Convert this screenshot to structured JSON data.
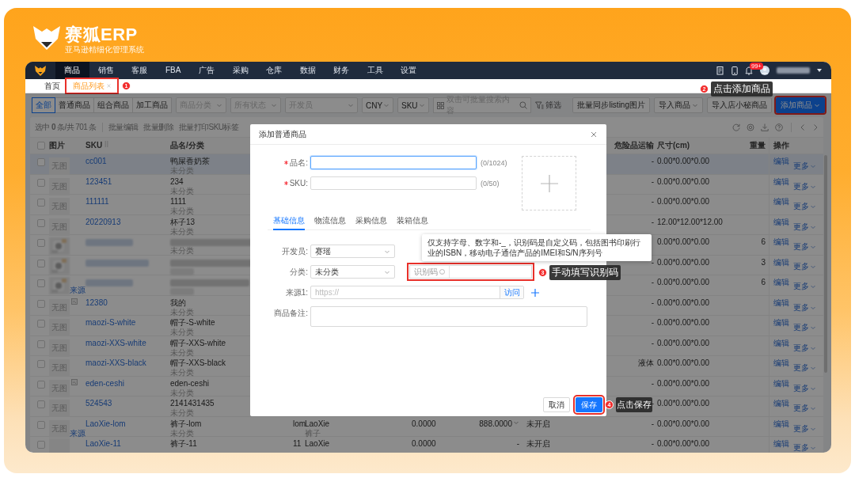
{
  "brand": {
    "name": "赛狐ERP",
    "tagline": "亚马逊精细化管理系统"
  },
  "nav": {
    "items": [
      {
        "label": "商品",
        "selected": true
      },
      {
        "label": "销售",
        "selected": false
      },
      {
        "label": "客服",
        "selected": false
      },
      {
        "label": "FBA",
        "selected": false
      },
      {
        "label": "广告",
        "selected": false
      },
      {
        "label": "采购",
        "selected": false
      },
      {
        "label": "仓库",
        "selected": false
      },
      {
        "label": "数据",
        "selected": false
      },
      {
        "label": "财务",
        "selected": false
      },
      {
        "label": "工具",
        "selected": false
      },
      {
        "label": "设置",
        "selected": false
      }
    ],
    "notification_badge": "99+"
  },
  "tabs": [
    {
      "label": "首页",
      "selected": false,
      "closable": false,
      "highlighted": false
    },
    {
      "label": "商品列表",
      "selected": true,
      "closable": true,
      "highlighted": true
    }
  ],
  "toolbar": {
    "segments": [
      {
        "label": "全部",
        "selected": true
      },
      {
        "label": "普通商品",
        "selected": false
      },
      {
        "label": "组合商品",
        "selected": false
      },
      {
        "label": "加工商品",
        "selected": false
      }
    ],
    "selects": [
      {
        "placeholder": "商品分类"
      },
      {
        "placeholder": "所有状态"
      },
      {
        "placeholder": "开发员"
      },
      {
        "value": "CNY"
      },
      {
        "value": "SKU"
      }
    ],
    "search": {
      "placeholder": "双击可批量搜索内容"
    },
    "filter": "筛选",
    "buttons": [
      {
        "label": "批量同步listing图片",
        "kind": "plain",
        "highlighted": false
      },
      {
        "label": "导入商品",
        "kind": "dropdown",
        "highlighted": false
      },
      {
        "label": "导入店小秘商品",
        "kind": "plain",
        "highlighted": false
      },
      {
        "label": "添加商品",
        "kind": "primary",
        "highlighted": true
      }
    ]
  },
  "bulk_bar": {
    "summary": "选中 **0** 条/共 701 条",
    "actions": [
      "批量编辑",
      "批量删除",
      "批量打印SKU标签"
    ]
  },
  "table": {
    "all_checked": false,
    "columns": [
      "图片",
      "SKU",
      "品名/分类",
      "危险品运输",
      "尺寸(cm)",
      "重量",
      "操作"
    ],
    "rows": [
      {
        "kind": "normal",
        "selected": true,
        "checked": false,
        "image": {
          "kind": "placeholder",
          "text": "无图"
        },
        "marked": false,
        "sku": "cc001",
        "name": "鸭屎香奶茶",
        "category": "未分类",
        "danger": "-",
        "size": "0.00*0.00*0.00",
        "actions": [
          "编辑",
          "更多"
        ]
      },
      {
        "kind": "normal",
        "selected": false,
        "checked": false,
        "image": {
          "kind": "placeholder",
          "text": "无图"
        },
        "marked": false,
        "sku": "123451",
        "name": "234",
        "category": "未分类",
        "danger": "-",
        "size": "0.00*0.00*0.00",
        "actions": [
          "编辑",
          "更多"
        ]
      },
      {
        "kind": "normal",
        "selected": false,
        "checked": false,
        "image": {
          "kind": "placeholder",
          "text": "无图"
        },
        "marked": false,
        "sku": "111111",
        "name": "1111",
        "category": "未分类",
        "danger": "-",
        "size": "0.00*0.00*0.00",
        "actions": [
          "编辑",
          "更多"
        ]
      },
      {
        "kind": "normal",
        "selected": false,
        "checked": false,
        "image": {
          "kind": "placeholder",
          "text": "无图"
        },
        "marked": false,
        "sku": "20220913",
        "name": "杯子13",
        "category": "未分类",
        "danger": "-",
        "size": "12.00*12.00*12.00",
        "actions": [
          "编辑",
          "更多"
        ]
      },
      {
        "kind": "blurred",
        "selected": false,
        "checked": false,
        "image": {
          "kind": "picture"
        },
        "marked": false,
        "category": "未分类",
        "size": "0.00*0.00*0.00",
        "weight": "6",
        "actions": [
          "编辑",
          "更多"
        ]
      },
      {
        "kind": "blurred",
        "selected": false,
        "checked": false,
        "image": {
          "kind": "picture"
        },
        "marked": false,
        "danger": "-",
        "size": "0.00*0.00*0.00",
        "weight": "3",
        "actions": [
          "编辑",
          "更多"
        ]
      },
      {
        "kind": "blurred",
        "selected": false,
        "checked": false,
        "image": {
          "kind": "picture"
        },
        "marked": false,
        "source_link": "来源",
        "danger": "-",
        "size": "0.00*0.00*0.00",
        "weight": "6",
        "actions": [
          "编辑",
          "更多"
        ]
      },
      {
        "kind": "normal",
        "selected": false,
        "checked": false,
        "image": {
          "kind": "placeholder",
          "text": "无图"
        },
        "marked": true,
        "sku": "12380",
        "name": "我的",
        "category": "未分类",
        "danger": "-",
        "size": "0.00*0.00*0.00",
        "actions": [
          "编辑",
          "更多"
        ]
      },
      {
        "kind": "normal",
        "selected": false,
        "checked": false,
        "image": {
          "kind": "placeholder",
          "text": "无图"
        },
        "marked": false,
        "sku": "maozi-S-white",
        "name": "帽子-S-white",
        "category": "未分类",
        "danger": "-",
        "size": "0.00*0.00*0.00",
        "actions": [
          "编辑",
          "更多"
        ]
      },
      {
        "kind": "normal",
        "selected": false,
        "checked": false,
        "image": {
          "kind": "placeholder",
          "text": "无图"
        },
        "marked": false,
        "sku": "maozi-XXS-white",
        "name": "帽子-XXS-white",
        "category": "未分类",
        "danger": "-",
        "size": "0.00*0.00*0.00",
        "actions": [
          "编辑",
          "更多"
        ]
      },
      {
        "kind": "normal",
        "selected": false,
        "checked": false,
        "image": {
          "kind": "placeholder",
          "text": "无图"
        },
        "marked": false,
        "sku": "maozi-XXS-black",
        "name": "帽子-XXS-black",
        "category": "未分类",
        "danger": "液体",
        "size": "0.00*0.00*0.00",
        "actions": [
          "编辑",
          "更多"
        ]
      },
      {
        "kind": "normal",
        "selected": false,
        "checked": false,
        "image": {
          "kind": "placeholder",
          "text": "无图"
        },
        "marked": true,
        "sku": "eden-ceshi",
        "name": "eden-ceshi",
        "category": "未分类",
        "danger": "-",
        "size": "0.00*0.00*0.00",
        "actions": [
          "编辑",
          "更多"
        ]
      },
      {
        "kind": "normal",
        "selected": false,
        "checked": false,
        "image": {
          "kind": "placeholder",
          "text": "无图"
        },
        "marked": false,
        "sku": "524543",
        "name": "2141431435",
        "category": "未分类",
        "danger": "-",
        "size": "0.00*0.00*0.00",
        "actions": [
          "编辑",
          "更多"
        ]
      },
      {
        "kind": "normal",
        "selected": false,
        "checked": false,
        "image": {
          "kind": "placeholder",
          "text": "无图"
        },
        "marked": false,
        "source_link": "来源",
        "sku": "LaoXie-lom",
        "name": "裤子-lom",
        "category": "未分类",
        "column_5": "lom",
        "column_6": "LaoXie",
        "column_6_sub": "裤子",
        "column_7": "0.0000",
        "column_8": "888.0000",
        "column_8_dropdown": true,
        "column_9": "未开启",
        "danger": "-",
        "size": "0.00*0.00*0.00",
        "actions": [
          "编辑",
          "更多"
        ]
      },
      {
        "kind": "normal",
        "selected": false,
        "checked": false,
        "image": {
          "kind": "placeholder"
        },
        "marked": false,
        "sku": "LaoXie-11",
        "name": "裤子-11",
        "column_5": "11",
        "column_6": "LaoXie",
        "column_7": "0.0000",
        "column_8": "-",
        "column_8_dropdown": false,
        "column_9": "未开启",
        "danger": "-",
        "size": "0.00*0.00*0.00",
        "actions": [
          "编辑",
          "更多"
        ]
      }
    ]
  },
  "dialog": {
    "title": "添加普通商品",
    "header_fields": [
      {
        "label": "品名:",
        "required": true,
        "counter": "(0/1024)",
        "focused": true
      },
      {
        "label": "SKU:",
        "required": true,
        "counter": "(0/50)",
        "focused": false
      }
    ],
    "tabs": [
      {
        "label": "基础信息",
        "selected": true
      },
      {
        "label": "物流信息",
        "selected": false
      },
      {
        "label": "采购信息",
        "selected": false
      },
      {
        "label": "装箱信息",
        "selected": false
      }
    ],
    "developer": {
      "label": "开发员:",
      "value": "赛瑶"
    },
    "category": {
      "label": "分类:",
      "value": "未分类"
    },
    "identifier": {
      "label": "识别码",
      "highlighted": true
    },
    "source": {
      "label": "来源1:",
      "placeholder": "https://",
      "button": "访问"
    },
    "note": {
      "label": "商品备注:"
    },
    "buttons": [
      {
        "label": "取消",
        "kind": "default",
        "highlighted": false
      },
      {
        "label": "保存",
        "kind": "primary",
        "highlighted": true
      }
    ]
  },
  "tooltip": "仅支持字母、数字和-_，识别码是自定义码，包括图书印刷行业的ISBN，移动电子通信产品的IMEI和S/N序列号",
  "annotations": [
    {
      "number": "1"
    },
    {
      "number": "2",
      "text": "点击添加商品"
    },
    {
      "number": "3",
      "text": "手动填写识别码"
    },
    {
      "number": "4",
      "text": "点击保存"
    }
  ]
}
